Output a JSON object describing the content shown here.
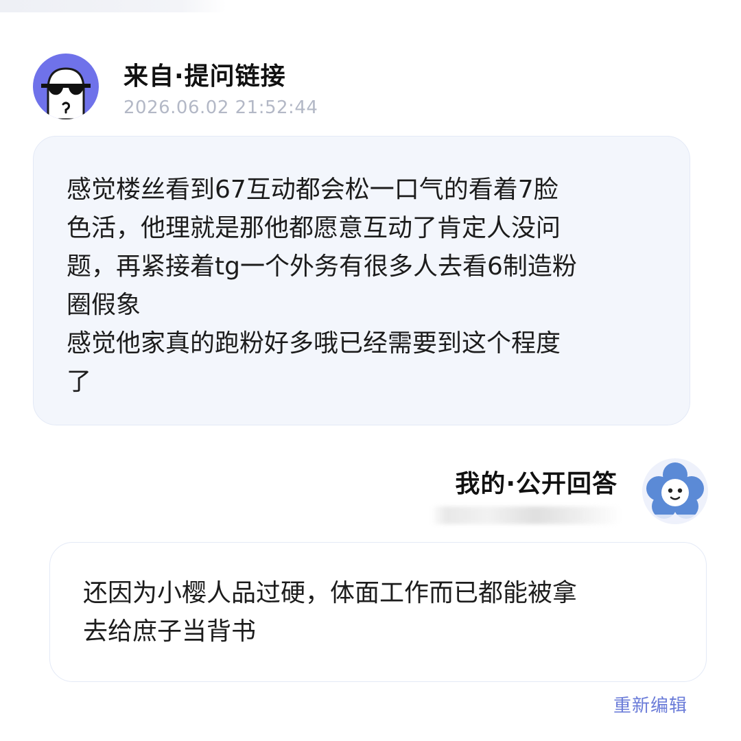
{
  "question": {
    "source_label": "来自·提问链接",
    "timestamp": "2026.06.02 21:52:44",
    "text": "感觉楼丝看到67互动都会松一口气的看着7脸\n色活，他理就是那他都愿意互动了肯定人没问\n题，再紧接着tg一个外务有很多人去看6制造粉\n圈假象\n感觉他家真的跑粉好多哦已经需要到这个程度\n了"
  },
  "answer": {
    "label": "我的·公开回答",
    "text": "还因为小樱人品过硬，体面工作而已都能被拿\n去给庶子当背书",
    "edit_label": "重新编辑",
    "edit_color": "#6a7bd8"
  },
  "avatars": {
    "asker_icon": "sunglasses-face-icon",
    "asker_bg": "#6f72ea",
    "me_icon": "flower-face-icon",
    "me_bg": "#5b8ad6"
  }
}
